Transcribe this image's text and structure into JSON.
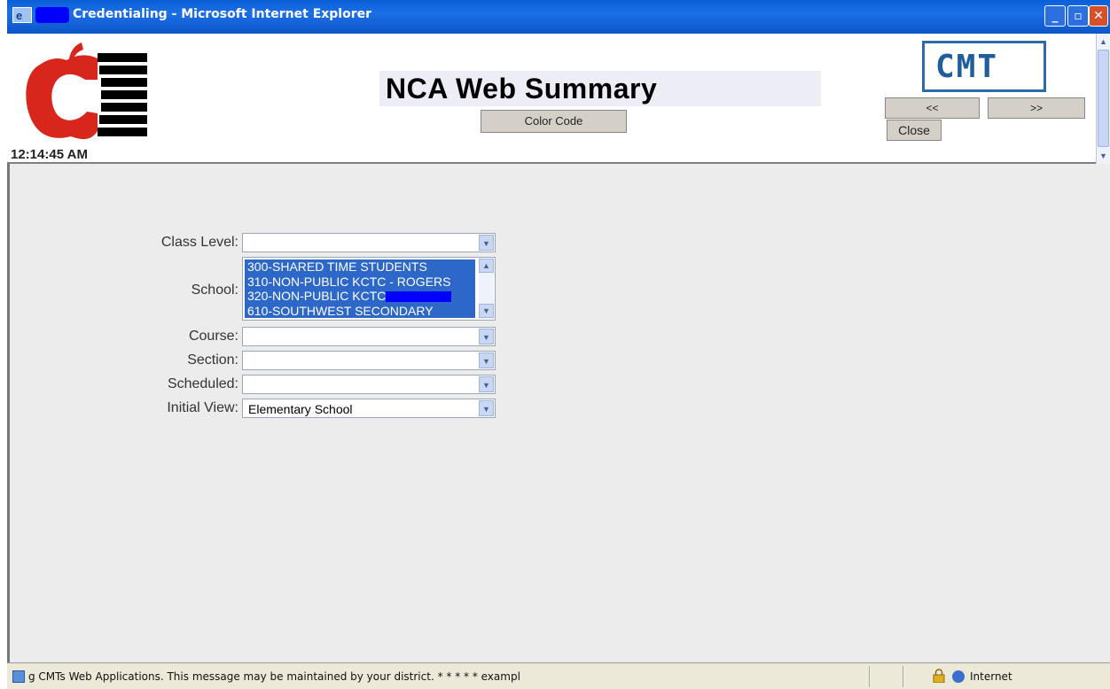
{
  "window": {
    "title": "Credentialing - Microsoft Internet Explorer",
    "controls": {
      "minimize": "_",
      "restore": "▫",
      "close": "✕"
    }
  },
  "header": {
    "clock": "12:14:45 AM",
    "title": "NCA Web Summary",
    "color_code_button": "Color Code",
    "brand": "CMT",
    "nav_prev": "<<",
    "nav_next": ">>",
    "close_button": "Close"
  },
  "form": {
    "class_level": {
      "label": "Class Level:",
      "value": ""
    },
    "school": {
      "label": "School:",
      "options": [
        {
          "text": "300-SHARED TIME STUDENTS"
        },
        {
          "text": "310-NON-PUBLIC KCTC - ROGERS"
        },
        {
          "text": "320-NON-PUBLIC KCTC"
        },
        {
          "text": "610-SOUTHWEST SECONDARY"
        }
      ]
    },
    "course": {
      "label": "Course:",
      "value": ""
    },
    "section": {
      "label": "Section:",
      "value": ""
    },
    "scheduled": {
      "label": "Scheduled:",
      "value": ""
    },
    "initial_view": {
      "label": "Initial View:",
      "value": "Elementary School"
    }
  },
  "statusbar": {
    "message": "g CMTs Web Applications.  This message may be maintained by your district.     *      *      *      *      *      exampl",
    "zone": "Internet"
  },
  "colors": {
    "title_bar": "#0b55c9",
    "selection": "#2d68c8",
    "logo_red": "#d8261c",
    "cmt_blue": "#1f5d9b"
  }
}
